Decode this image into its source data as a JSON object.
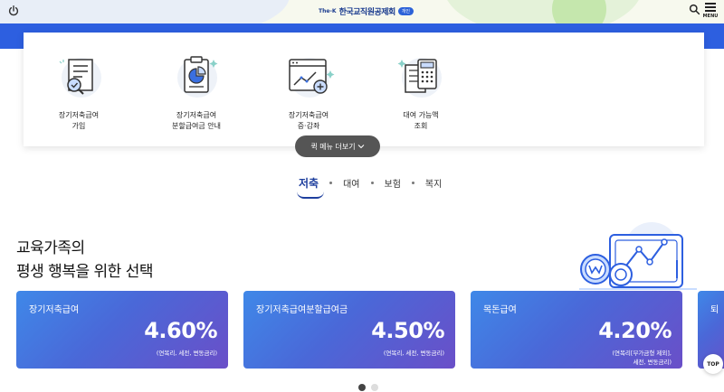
{
  "header": {
    "logo_prefix": "The-K",
    "logo_name": "한국교직원공제회",
    "logo_badge": "개인",
    "menu_label": "MENU"
  },
  "quick_menu": {
    "items": [
      {
        "label": "장기저축급여\n가입",
        "icon": "document-search-icon"
      },
      {
        "label": "장기저축급여\n분할급여금 안내",
        "icon": "pie-chart-clipboard-icon"
      },
      {
        "label": "장기저축급여\n증·감좌",
        "icon": "growth-chart-window-icon"
      },
      {
        "label": "대여 가능액\n조회",
        "icon": "calculator-document-icon"
      }
    ],
    "more_label": "퀵 메뉴 더보기"
  },
  "tabs": [
    {
      "label": "저축",
      "active": true
    },
    {
      "label": "대여",
      "active": false
    },
    {
      "label": "보험",
      "active": false
    },
    {
      "label": "복지",
      "active": false
    }
  ],
  "hero": {
    "title": "교육가족의\n평생 행복을 위한 선택"
  },
  "rate_cards": [
    {
      "title": "장기저축급여",
      "value": "4.60%",
      "note": "(연복리, 세전, 변동금리)"
    },
    {
      "title": "장기저축급여분할급여금",
      "value": "4.50%",
      "note": "(연복리, 세전, 변동금리)"
    },
    {
      "title": "목돈급여",
      "value": "4.20%",
      "note": "(연복리[부가금형 제외],\n세전, 변동금리)"
    },
    {
      "title": "퇴",
      "value": "",
      "note": ""
    }
  ],
  "top_label": "TOP",
  "pager": {
    "total": 2,
    "current": 1
  },
  "colors": {
    "brand_blue": "#2d5fe0",
    "navy": "#1e3f9e",
    "card_gradient_start": "#3f88e8",
    "card_gradient_end": "#6a4fc8"
  }
}
